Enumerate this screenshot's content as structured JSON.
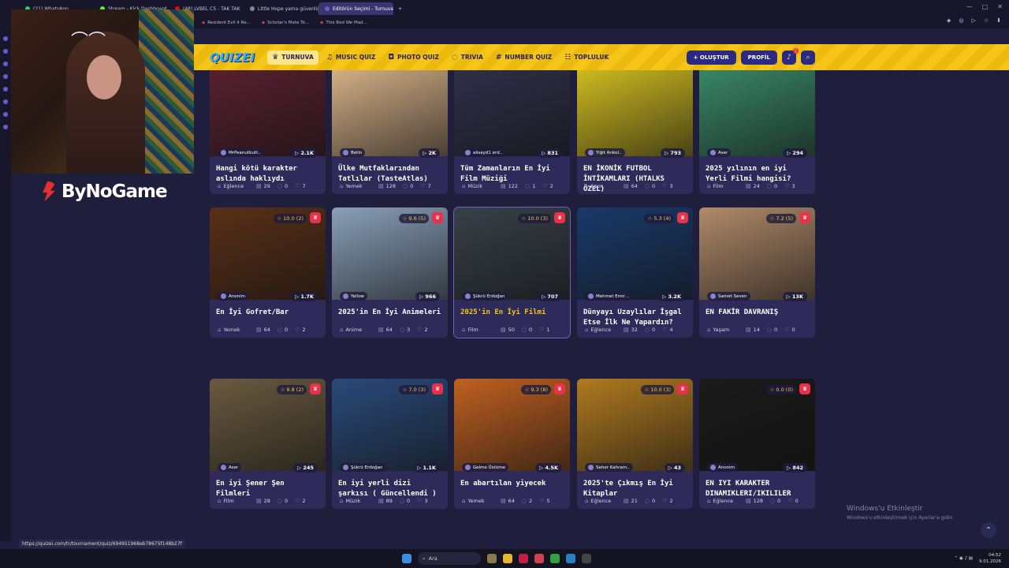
{
  "browser": {
    "tabs": [
      {
        "label": "(21) WhatsApp",
        "color": "#25d366"
      },
      {
        "label": "Stream - Kick Dashboard",
        "color": "#53fc18"
      },
      {
        "label": "(48) LVBEL C5 - TAK TAK",
        "color": "#ff0000"
      },
      {
        "label": "Little Hope yama güvenliği",
        "color": "#888888"
      },
      {
        "label": "Editörün Seçimi - Turnuva",
        "color": "#6a5ad0",
        "active": true
      }
    ],
    "bookmarks": [
      "Resident Evil 4 Re...",
      "Scholar's Mate To...",
      "This Bed We Mad..."
    ],
    "status_url": "https://quizei.com/tr/tournament/quiz/694951968eb78675f148b27f"
  },
  "stream_logo": "ByNoGame",
  "site": {
    "logo": "QUIZEI",
    "nav": [
      {
        "label": "TURNUVA",
        "icon": "trophy-icon",
        "glyph": "♛",
        "active": true
      },
      {
        "label": "MUSIC QUIZ",
        "icon": "music-icon",
        "glyph": "♫"
      },
      {
        "label": "PHOTO QUIZ",
        "icon": "camera-icon",
        "glyph": "◘"
      },
      {
        "label": "TRIVIA",
        "icon": "chat-icon",
        "glyph": "◌"
      },
      {
        "label": "NUMBER QUIZ",
        "icon": "hash-icon",
        "glyph": "#"
      },
      {
        "label": "TOPLULUK",
        "icon": "users-icon",
        "glyph": "☷"
      }
    ],
    "create_label": "+ OLUŞTUR",
    "profile_label": "PROFİL",
    "notif_count": "1"
  },
  "cards": [
    {
      "title": "Hangi kötü karakter aslında haklıydı",
      "author": "MrPeanutbutt..",
      "plays": "2.1K",
      "cat": "Eğlence",
      "q": "29",
      "c": "0",
      "l": "7",
      "thumb": "#5a2030"
    },
    {
      "title": "Ülke Mutfaklarından Tatlılar (TasteAtlas)",
      "author": "Betin",
      "plays": "2K",
      "cat": "Yemek",
      "q": "128",
      "c": "0",
      "l": "7",
      "thumb": "#d9b48a"
    },
    {
      "title": "Tüm Zamanların En İyi Film Müziği",
      "author": "alisayd1 erd..",
      "plays": "831",
      "cat": "Müzik",
      "q": "122",
      "c": "1",
      "l": "2",
      "thumb": "#30304a"
    },
    {
      "title": "EN İKONİK FUTBOL İNTİKAMLARI (HTALKS ÖZEL)",
      "author": "Yiğit Arıkol..",
      "plays": "793",
      "cat": "Spor",
      "q": "64",
      "c": "0",
      "l": "3",
      "thumb": "#d4c020"
    },
    {
      "title": "2025 yılının en iyi Yerli Filmi hangisi?",
      "author": "Aser",
      "plays": "294",
      "cat": "Film",
      "q": "24",
      "c": "0",
      "l": "3",
      "thumb": "#3a8a6a"
    },
    {
      "title": "En İyi Gofret/Bar",
      "author": "Anonim",
      "plays": "1.7K",
      "rating": "10.0 (2)",
      "cat": "Yemek",
      "q": "64",
      "c": "0",
      "l": "2",
      "thumb": "#5a3018"
    },
    {
      "title": "2025'in En İyi Animeleri",
      "author": "Yellow",
      "plays": "966",
      "rating": "9.6 (5)",
      "cat": "Anime",
      "q": "64",
      "c": "3",
      "l": "2",
      "thumb": "#8aa0b8"
    },
    {
      "title": "2025'in En İyi Filmi",
      "author": "Şükrü Erdoğan",
      "plays": "707",
      "rating": "10.0 (3)",
      "cat": "Film",
      "q": "50",
      "c": "0",
      "l": "1",
      "thumb": "#384048",
      "hover": true
    },
    {
      "title": "Dünyayı Uzaylılar İşgal Etse İlk Ne Yapardın?",
      "author": "Mehmet Emir ..",
      "plays": "3.2K",
      "rating": "5.3 (4)",
      "cat": "Eğlence",
      "q": "32",
      "c": "0",
      "l": "4",
      "thumb": "#1a3a6a"
    },
    {
      "title": "EN FAKİR DAVRANIŞ",
      "author": "Samet Seven",
      "plays": "13K",
      "rating": "7.2 (5)",
      "cat": "Yaşam",
      "q": "14",
      "c": "0",
      "l": "0",
      "thumb": "#b08a6a"
    },
    {
      "title": "En iyi Şener Şen Filmleri",
      "author": "Aser",
      "plays": "245",
      "rating": "9.8 (2)",
      "cat": "Film",
      "q": "28",
      "c": "0",
      "l": "2",
      "thumb": "#6a5a40"
    },
    {
      "title": "En iyi yerli dizi şarkısı ( Güncellendi )",
      "author": "Şükrü Erdoğan",
      "plays": "1.1K",
      "rating": "7.0 (3)",
      "cat": "Müzik",
      "q": "89",
      "c": "0",
      "l": "3",
      "thumb": "#2a4a7a"
    },
    {
      "title": "En abartılan yiyecek",
      "author": "Gelme Üstüme",
      "plays": "4.5K",
      "rating": "9.3 (8)",
      "cat": "Yemek",
      "q": "64",
      "c": "2",
      "l": "5",
      "thumb": "#c06020"
    },
    {
      "title": "2025'te Çıkmış En İyi Kitaplar",
      "author": "Seher Kahram..",
      "plays": "43",
      "rating": "10.0 (3)",
      "cat": "Eğlence",
      "q": "21",
      "c": "0",
      "l": "2",
      "thumb": "#b07a20"
    },
    {
      "title": "EN IYI KARAKTER DINAMIKLERI/IKILILER",
      "author": "Anonim",
      "plays": "842",
      "rating": "0.0 (0)",
      "cat": "Eğlence",
      "q": "128",
      "c": "0",
      "l": "0",
      "thumb": "#1a1a1a"
    }
  ],
  "watermark": {
    "title": "Windows'u Etkinleştir",
    "sub": "Windows'u etkinleştirmek için Ayarlar'a gidin."
  },
  "taskbar": {
    "search": "Ara",
    "time": "04:52",
    "date": "9.01.2026"
  }
}
